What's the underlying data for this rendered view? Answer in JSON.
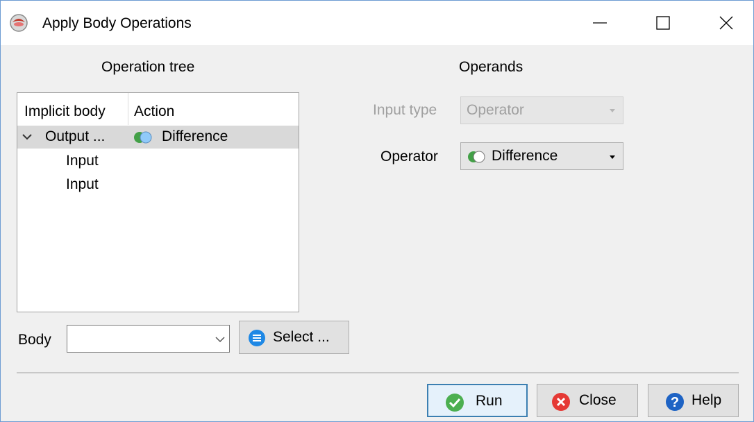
{
  "window": {
    "title": "Apply Body Operations",
    "controls": [
      "minimize-icon",
      "maximize-icon",
      "close-icon"
    ]
  },
  "operation_tree": {
    "heading": "Operation tree",
    "columns": [
      "Implicit body",
      "Action"
    ],
    "rows": [
      {
        "name": "Output ...",
        "action": "Difference",
        "expanded": true,
        "selected": true
      },
      {
        "name": "Input",
        "action": ""
      },
      {
        "name": "Input",
        "action": ""
      }
    ]
  },
  "operands": {
    "heading": "Operands",
    "input_type_label": "Input type",
    "input_type_value": "Operator",
    "operator_label": "Operator",
    "operator_value": "Difference"
  },
  "body": {
    "label": "Body",
    "value": "",
    "select_label": "Select ..."
  },
  "buttons": {
    "run": "Run",
    "close": "Close",
    "help": "Help"
  },
  "colors": {
    "run_icon": "#4caf50",
    "close_icon": "#e53935",
    "help_icon": "#1e63c4",
    "select_icon": "#1e88e5",
    "accent_border": "#3c7fb1"
  }
}
